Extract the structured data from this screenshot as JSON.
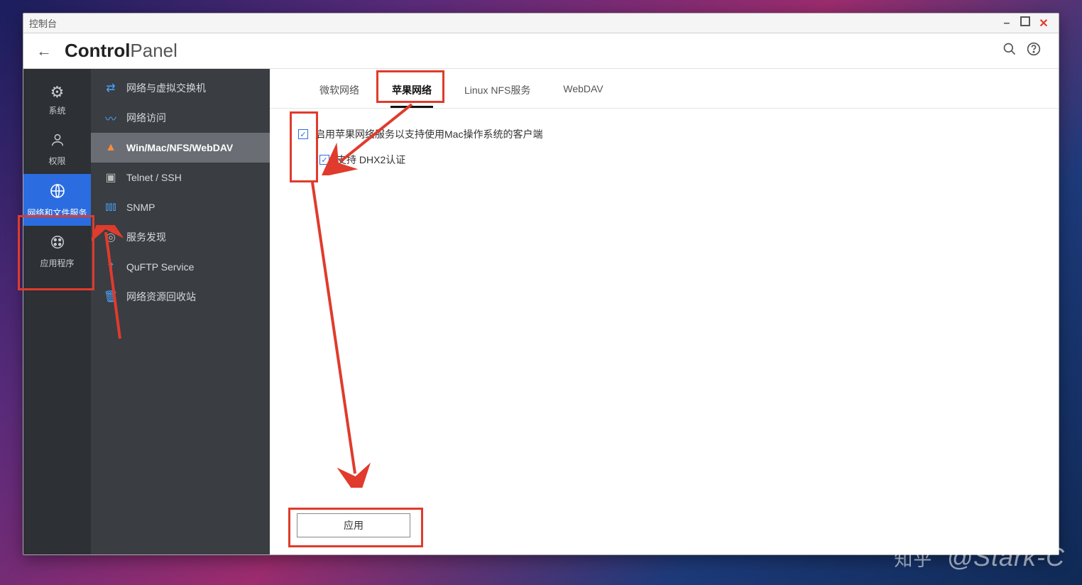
{
  "window": {
    "title": "控制台"
  },
  "header": {
    "title_bold": "Control",
    "title_light": "Panel"
  },
  "rail": {
    "items": [
      {
        "label": "系统"
      },
      {
        "label": "权限"
      },
      {
        "label": "网络和文件服务"
      },
      {
        "label": "应用程序"
      }
    ]
  },
  "sidebar": {
    "items": [
      {
        "label": "网络与虚拟交换机"
      },
      {
        "label": "网络访问"
      },
      {
        "label": "Win/Mac/NFS/WebDAV"
      },
      {
        "label": "Telnet / SSH"
      },
      {
        "label": "SNMP"
      },
      {
        "label": "服务发现"
      },
      {
        "label": "QuFTP Service"
      },
      {
        "label": "网络资源回收站"
      }
    ]
  },
  "tabs": [
    {
      "label": "微软网络"
    },
    {
      "label": "苹果网络"
    },
    {
      "label": "Linux NFS服务"
    },
    {
      "label": "WebDAV"
    }
  ],
  "options": {
    "enable_apple": "启用苹果网络服务以支持使用Mac操作系统的客户端",
    "support_dhx2": "支持 DHX2认证"
  },
  "footer": {
    "apply": "应用"
  },
  "watermark": {
    "zh": "知乎",
    "author": "@Stark-C"
  }
}
